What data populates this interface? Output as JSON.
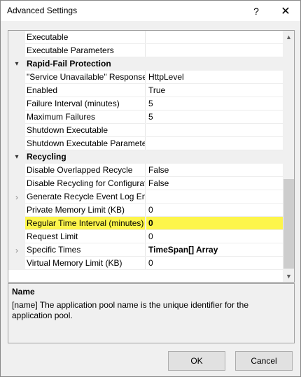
{
  "window": {
    "title": "Advanced Settings",
    "help_glyph": "?",
    "close_glyph": "✕"
  },
  "grid": {
    "rows": [
      {
        "type": "prop",
        "name": "Executable",
        "value": ""
      },
      {
        "type": "prop",
        "name": "Executable Parameters",
        "value": ""
      },
      {
        "type": "category",
        "name": "Rapid-Fail Protection"
      },
      {
        "type": "prop",
        "name": "\"Service Unavailable\" Response Type",
        "value": "HttpLevel"
      },
      {
        "type": "prop",
        "name": "Enabled",
        "value": "True"
      },
      {
        "type": "prop",
        "name": "Failure Interval (minutes)",
        "value": "5"
      },
      {
        "type": "prop",
        "name": "Maximum Failures",
        "value": "5"
      },
      {
        "type": "prop",
        "name": "Shutdown Executable",
        "value": ""
      },
      {
        "type": "prop",
        "name": "Shutdown Executable Parameters",
        "value": ""
      },
      {
        "type": "category",
        "name": "Recycling"
      },
      {
        "type": "prop",
        "name": "Disable Overlapped Recycle",
        "value": "False"
      },
      {
        "type": "prop",
        "name": "Disable Recycling for Configuration Changes",
        "value": "False"
      },
      {
        "type": "expandable",
        "name": "Generate Recycle Event Log Entry",
        "value": ""
      },
      {
        "type": "prop",
        "name": "Private Memory Limit (KB)",
        "value": "0"
      },
      {
        "type": "prop",
        "name": "Regular Time Interval (minutes)",
        "value": "0",
        "highlighted": true
      },
      {
        "type": "prop",
        "name": "Request Limit",
        "value": "0"
      },
      {
        "type": "expandable",
        "name": "Specific Times",
        "value": "TimeSpan[] Array",
        "bold_value": true
      },
      {
        "type": "prop",
        "name": "Virtual Memory Limit (KB)",
        "value": "0"
      }
    ]
  },
  "description": {
    "title": "Name",
    "text": "[name] The application pool name is the unique identifier for the application pool."
  },
  "buttons": {
    "ok": "OK",
    "cancel": "Cancel"
  },
  "colors": {
    "highlight": "#fdf54b",
    "dialog_bg": "#f0f0f0"
  }
}
